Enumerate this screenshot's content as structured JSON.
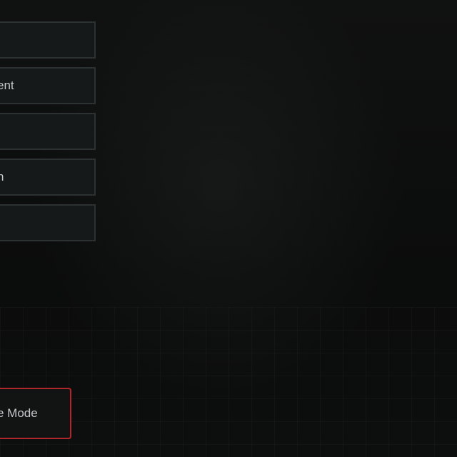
{
  "menu": {
    "items": [
      {
        "label": ""
      },
      {
        "label": "ent"
      },
      {
        "label": ""
      },
      {
        "label": "n"
      },
      {
        "label": ""
      }
    ]
  },
  "mode_button": {
    "label": "e Mode"
  },
  "colors": {
    "background": "#0c0d0d",
    "button_fill": "#161919",
    "button_border": "#2c3131",
    "accent_red": "#b0262b",
    "text": "#c4c8c8"
  }
}
